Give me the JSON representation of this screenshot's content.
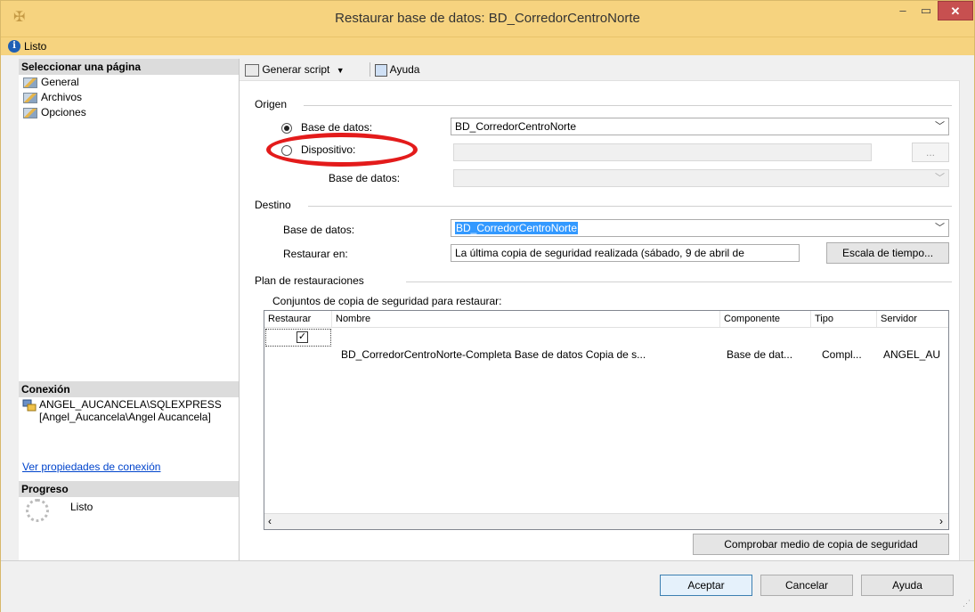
{
  "window": {
    "title": "Restaurar base de datos: BD_CorredorCentroNorte",
    "status": "Listo",
    "close_glyph": "✕",
    "min_glyph": "–",
    "max_glyph": "▭"
  },
  "left_pane": {
    "select_page_header": "Seleccionar una página",
    "pages": [
      "General",
      "Archivos",
      "Opciones"
    ],
    "connection_header": "Conexión",
    "connection_text": "ANGEL_AUCANCELA\\SQLEXPRESS [Angel_Aucancela\\Angel Aucancela]",
    "connection_link": "Ver propiedades de conexión",
    "progress_header": "Progreso",
    "progress_status": "Listo"
  },
  "toolbar": {
    "script_label": "Generar script",
    "help_label": "Ayuda"
  },
  "origen": {
    "section": "Origen",
    "database_radio_label": "Base de datos:",
    "database_value": "BD_CorredorCentroNorte",
    "device_radio_label": "Dispositivo:",
    "device_value": "",
    "device_browse": "...",
    "device_db_label": "Base de datos:",
    "device_db_value": ""
  },
  "destino": {
    "section": "Destino",
    "database_label": "Base de datos:",
    "database_value": "BD_CorredorCentroNorte",
    "restore_to_label": "Restaurar en:",
    "restore_to_value": "La última copia de seguridad realizada (sábado, 9 de abril de",
    "timeline_button": "Escala de tiempo..."
  },
  "plan": {
    "section": "Plan de restauraciones",
    "sets_label": "Conjuntos de copia de seguridad para restaurar:",
    "columns": [
      "Restaurar",
      "Nombre",
      "Componente",
      "Tipo",
      "Servidor"
    ],
    "rows": [
      {
        "restore": true,
        "name": "BD_CorredorCentroNorte-Completa Base de datos Copia de s...",
        "component": "Base de dat...",
        "type": "Compl...",
        "server": "ANGEL_AU"
      }
    ],
    "verify_button": "Comprobar medio de copia de seguridad"
  },
  "footer": {
    "ok": "Aceptar",
    "cancel": "Cancelar",
    "help": "Ayuda"
  },
  "colors": {
    "titlebar": "#f6d37f",
    "annotation": "#e31b1b",
    "selection": "#3399ff"
  }
}
